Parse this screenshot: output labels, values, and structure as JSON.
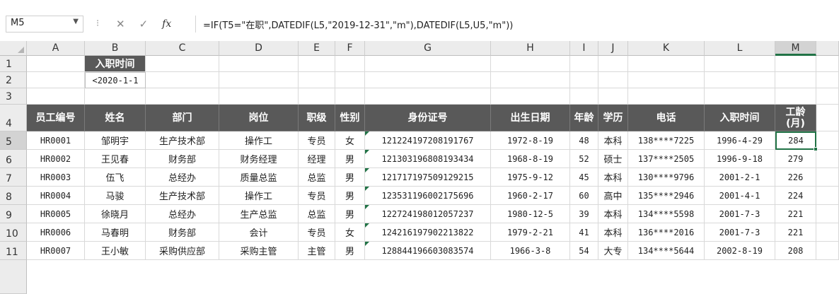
{
  "namebox": "M5",
  "formula": "=IF(T5=\"在职\",DATEDIF(L5,\"2019-12-31\",\"m\"),DATEDIF(L5,U5,\"m\"))",
  "columns": [
    "A",
    "B",
    "C",
    "D",
    "E",
    "F",
    "G",
    "H",
    "I",
    "J",
    "K",
    "L",
    "M"
  ],
  "rows": [
    "1",
    "2",
    "3",
    "4",
    "5",
    "6",
    "7",
    "8",
    "9",
    "10",
    "11"
  ],
  "b1": "入职时间",
  "b2": "<2020-1-1",
  "headers": [
    "员工编号",
    "姓名",
    "部门",
    "岗位",
    "职级",
    "性别",
    "身份证号",
    "出生日期",
    "年龄",
    "学历",
    "电话",
    "入职时间",
    "工龄\n(月)"
  ],
  "records": [
    [
      "HR0001",
      "邹明宇",
      "生产技术部",
      "操作工",
      "专员",
      "女",
      "121224197208191767",
      "1972-8-19",
      "48",
      "本科",
      "138****7225",
      "1996-4-29",
      "284"
    ],
    [
      "HR0002",
      "王见春",
      "财务部",
      "财务经理",
      "经理",
      "男",
      "121303196808193434",
      "1968-8-19",
      "52",
      "硕士",
      "137****2505",
      "1996-9-18",
      "279"
    ],
    [
      "HR0003",
      "伍飞",
      "总经办",
      "质量总监",
      "总监",
      "男",
      "121717197509129215",
      "1975-9-12",
      "45",
      "本科",
      "130****9796",
      "2001-2-1",
      "226"
    ],
    [
      "HR0004",
      "马骏",
      "生产技术部",
      "操作工",
      "专员",
      "男",
      "123531196002175696",
      "1960-2-17",
      "60",
      "高中",
      "135****2946",
      "2001-4-1",
      "224"
    ],
    [
      "HR0005",
      "徐晓月",
      "总经办",
      "生产总监",
      "总监",
      "男",
      "122724198012057237",
      "1980-12-5",
      "39",
      "本科",
      "134****5598",
      "2001-7-3",
      "221"
    ],
    [
      "HR0006",
      "马春明",
      "财务部",
      "会计",
      "专员",
      "女",
      "124216197902213822",
      "1979-2-21",
      "41",
      "本科",
      "136****2016",
      "2001-7-3",
      "221"
    ],
    [
      "HR0007",
      "王小敏",
      "采购供应部",
      "采购主管",
      "主管",
      "男",
      "128844196603083574",
      "1966-3-8",
      "54",
      "大专",
      "134****5644",
      "2002-8-19",
      "208"
    ]
  ]
}
